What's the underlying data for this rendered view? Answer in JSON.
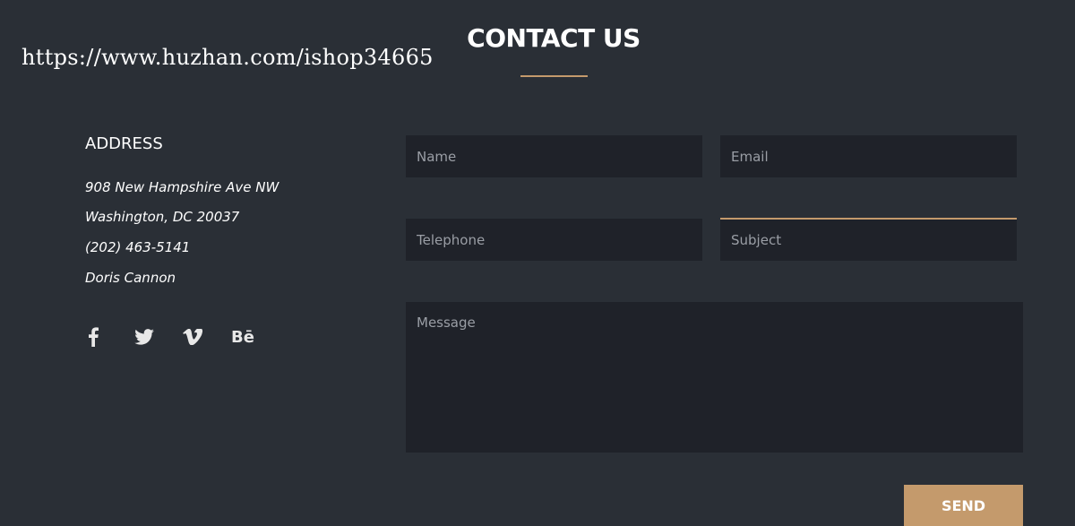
{
  "watermark": "https://www.huzhan.com/ishop34665",
  "section": {
    "title": "CONTACT US",
    "accent_color": "#c49a6c"
  },
  "address": {
    "heading": "ADDRESS",
    "lines": [
      "908 New Hampshire Ave NW",
      "Washington, DC 20037",
      "(202) 463-5141",
      "Doris Cannon"
    ]
  },
  "social": {
    "icons": [
      "facebook-icon",
      "twitter-icon",
      "vimeo-icon",
      "behance-icon"
    ],
    "behance_glyph": "Bē"
  },
  "form": {
    "name_placeholder": "Name",
    "email_placeholder": "Email",
    "telephone_placeholder": "Telephone",
    "subject_placeholder": "Subject",
    "message_placeholder": "Message",
    "send_label": "SEND"
  },
  "colors": {
    "background": "#2a2f36",
    "field_background": "#1f2229",
    "accent": "#c49a6c"
  }
}
